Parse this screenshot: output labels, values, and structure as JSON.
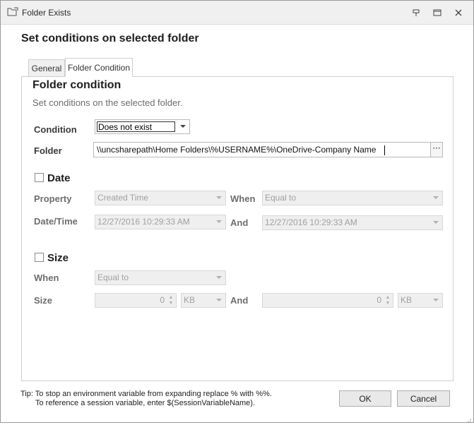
{
  "window": {
    "title": "Folder Exists"
  },
  "heading": "Set conditions on selected folder",
  "tabs": [
    {
      "label": "General",
      "active": false
    },
    {
      "label": "Folder Condition",
      "active": true
    }
  ],
  "section": {
    "title": "Folder condition",
    "description": "Set conditions on the selected folder."
  },
  "condition": {
    "label": "Condition",
    "value": "Does not exist"
  },
  "folder": {
    "label": "Folder",
    "value": "\\\\uncsharepath\\Home Folders\\%USERNAME%\\OneDrive-Company Name",
    "browse_label": "···"
  },
  "date": {
    "title": "Date",
    "checked": false,
    "property_label": "Property",
    "property_value": "Created Time",
    "when_label": "When",
    "when_value": "Equal to",
    "datetime_label": "Date/Time",
    "datetime_value": "12/27/2016 10:29:33 AM",
    "and_label": "And",
    "and_value": "12/27/2016 10:29:33 AM"
  },
  "size": {
    "title": "Size",
    "checked": false,
    "when_label": "When",
    "when_value": "Equal to",
    "size_label": "Size",
    "size_value": "0",
    "size_unit": "KB",
    "and_label": "And",
    "and_value": "0",
    "and_unit": "KB"
  },
  "tip": {
    "line1": "Tip: To stop an environment variable from expanding replace % with %%.",
    "line2": "To reference a session variable, enter $(SessionVariableName)."
  },
  "buttons": {
    "ok": "OK",
    "cancel": "Cancel"
  },
  "colors": {
    "disabled_bg": "#efefef",
    "border": "#cfcfcf"
  }
}
